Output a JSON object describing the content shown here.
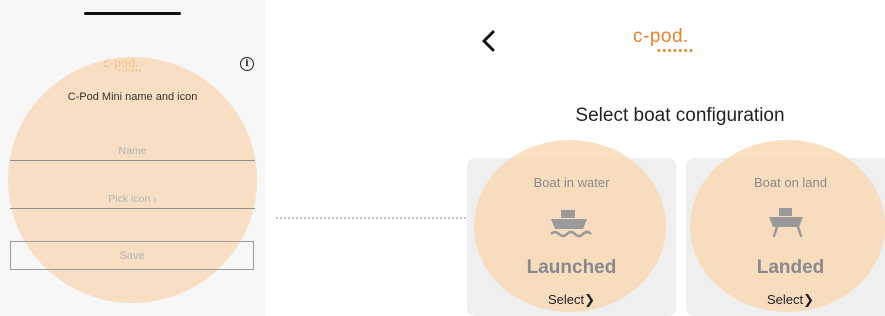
{
  "left_screen": {
    "logo_text": "c-pod.",
    "logo_dots": "•••••••",
    "info_icon": "ⓘ",
    "subtitle": "C-Pod Mini name and icon",
    "name_placeholder": "Name",
    "pick_icon_label": "Pick icon  ›",
    "save_label": "Save"
  },
  "right_screen": {
    "back_icon": "chevron-left-icon",
    "logo_text": "c-pod.",
    "logo_dots": "•••••••",
    "heading": "Select boat configuration",
    "cards": [
      {
        "title": "Boat in water",
        "icon": "boat-in-water-icon",
        "status": "Launched",
        "select_label": "Select",
        "select_chevron": "❯"
      },
      {
        "title": "Boat on land",
        "icon": "boat-on-land-icon",
        "status": "Landed",
        "select_label": "Select",
        "select_chevron": "❯"
      }
    ]
  },
  "colors": {
    "brand_orange": "#e9822a",
    "highlight": "#f8d6b0",
    "card_bg": "#efefef",
    "muted_text": "#8a8a8a"
  }
}
